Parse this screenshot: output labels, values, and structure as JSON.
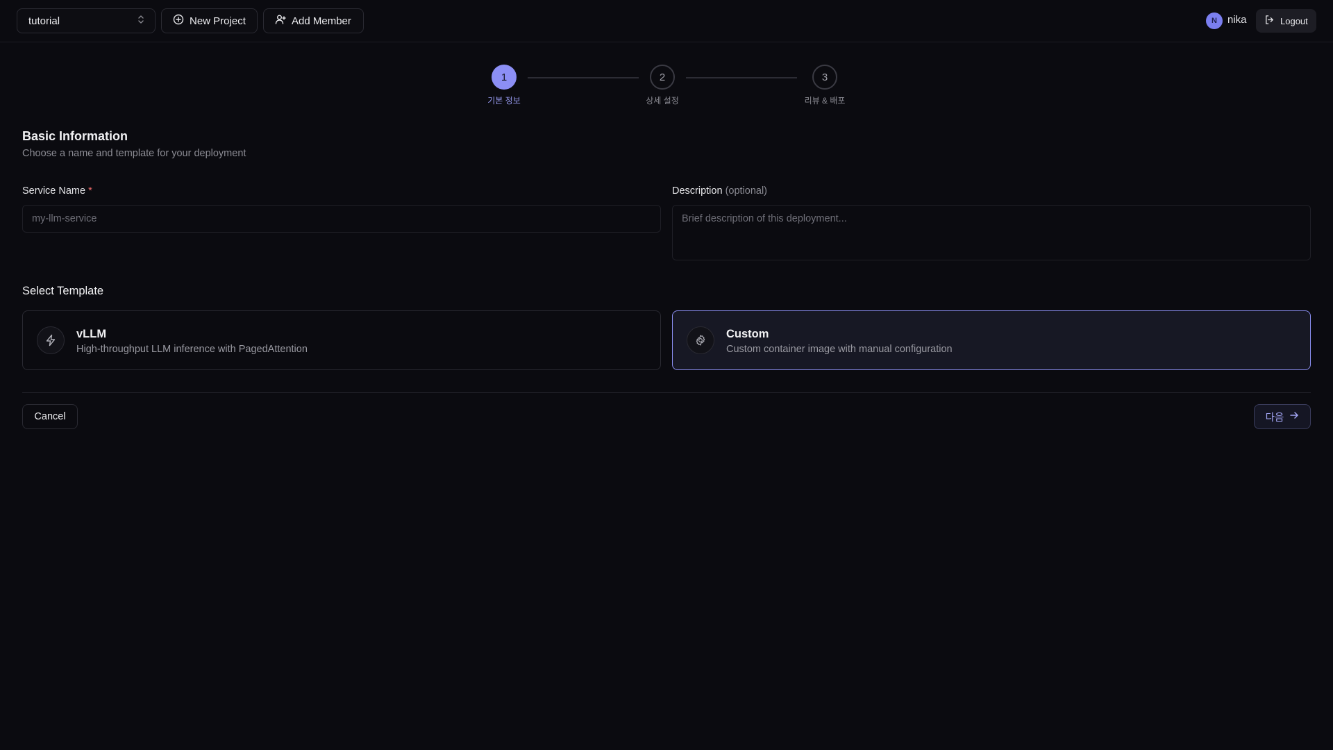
{
  "topbar": {
    "project": "tutorial",
    "new_project": "New Project",
    "add_member": "Add Member",
    "avatar_initial": "N",
    "username": "nika",
    "logout": "Logout"
  },
  "stepper": {
    "steps": [
      {
        "number": "1",
        "label": "기본 정보",
        "state": "active"
      },
      {
        "number": "2",
        "label": "상세 설정",
        "state": "inactive"
      },
      {
        "number": "3",
        "label": "리뷰 & 배포",
        "state": "inactive"
      }
    ]
  },
  "section": {
    "title": "Basic Information",
    "subtitle": "Choose a name and template for your deployment"
  },
  "form": {
    "service_name_label": "Service Name",
    "required_mark": "*",
    "service_name_placeholder": "my-llm-service",
    "service_name_value": "",
    "description_label": "Description",
    "description_optional": "(optional)",
    "description_placeholder": "Brief description of this deployment...",
    "description_value": ""
  },
  "templates": {
    "title": "Select Template",
    "items": [
      {
        "name": "vLLM",
        "description": "High-throughput LLM inference with PagedAttention",
        "icon": "lightning-icon",
        "selected": false
      },
      {
        "name": "Custom",
        "description": "Custom container image with manual configuration",
        "icon": "gear-icon",
        "selected": true
      }
    ]
  },
  "footer": {
    "cancel": "Cancel",
    "next": "다음"
  },
  "colors": {
    "background": "#0b0b10",
    "accent": "#8c8ff5",
    "required": "#ef6b6b"
  }
}
